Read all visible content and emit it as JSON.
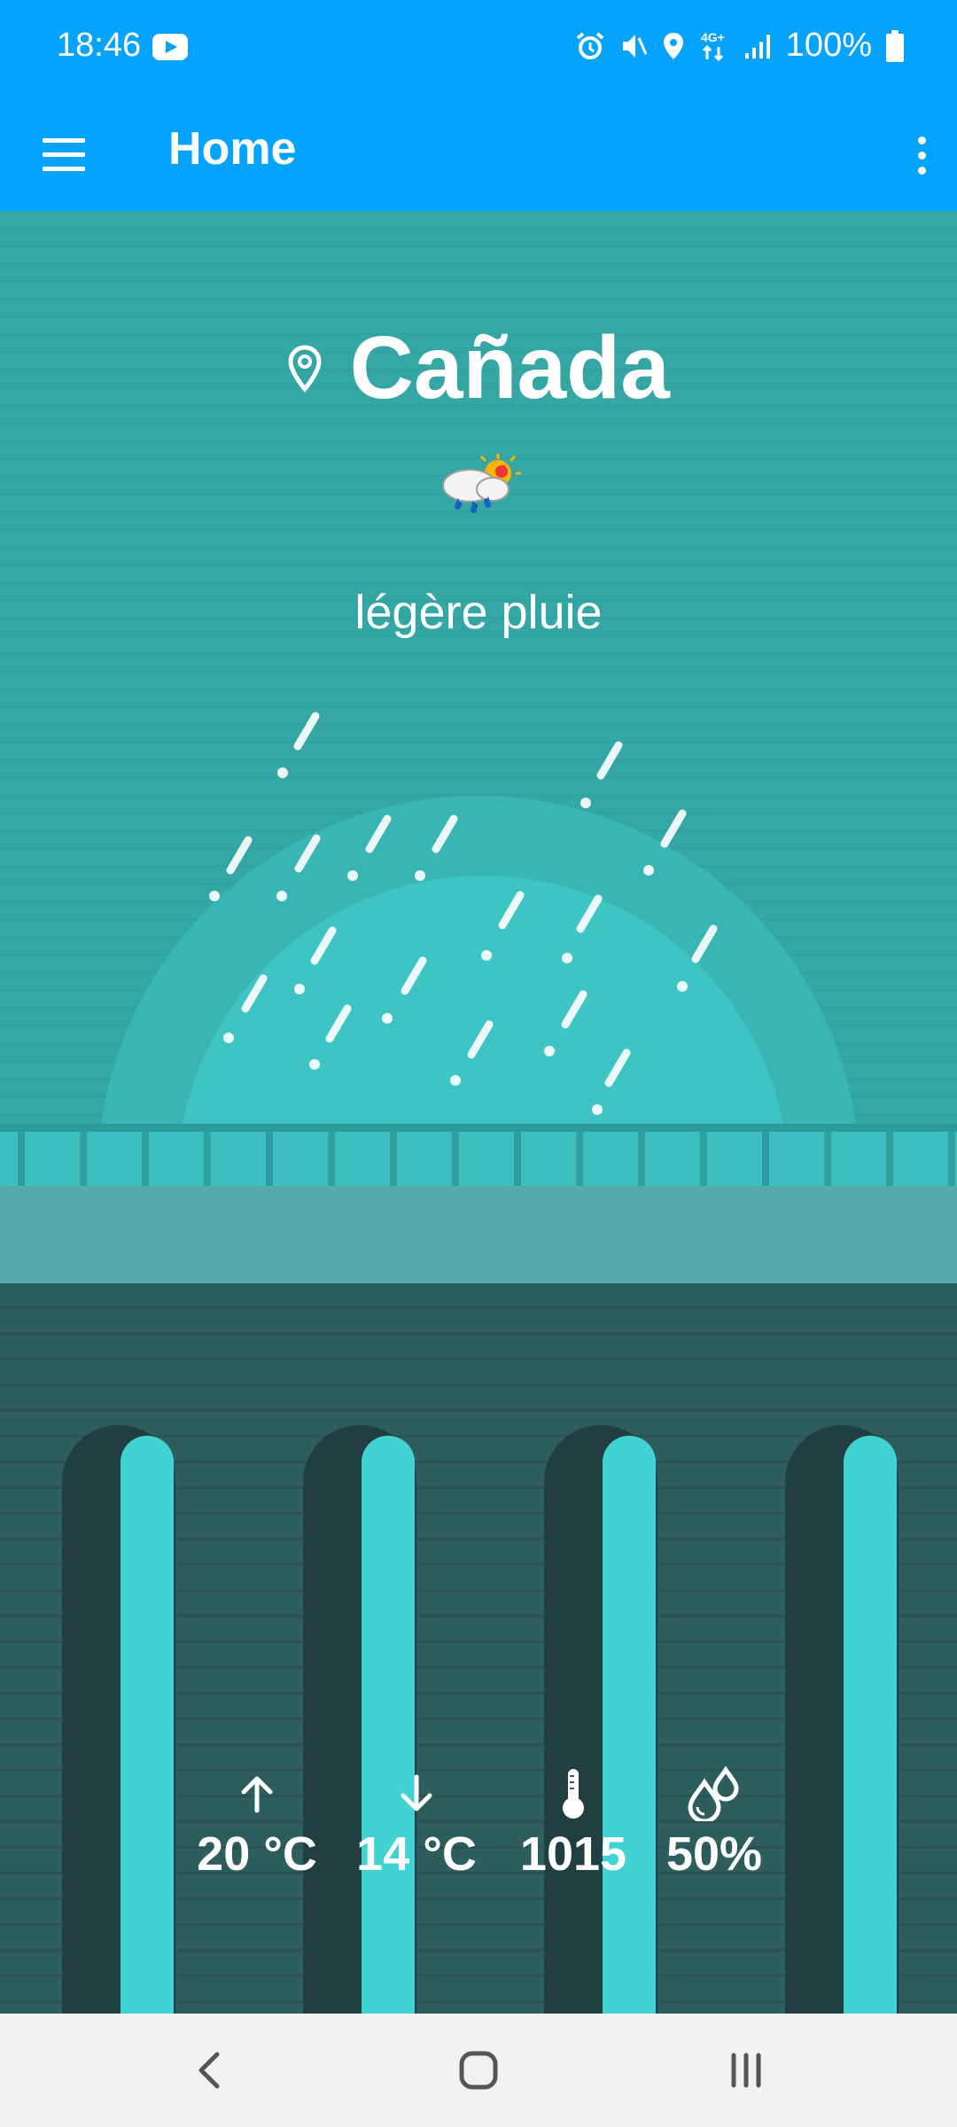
{
  "status_bar": {
    "time": "18:46",
    "battery": "100%",
    "network": "4G+",
    "icons": [
      "youtube-icon",
      "alarm-icon",
      "mute-icon",
      "location-icon",
      "data-icon",
      "signal-icon",
      "battery-icon"
    ]
  },
  "app_bar": {
    "title": "Home",
    "menu_icon": "menu-icon",
    "more_icon": "more-vert-icon",
    "color": "#03a3ff"
  },
  "weather": {
    "city": "Cañada",
    "description": "légère pluie",
    "icon": "rain-sun-icon"
  },
  "stats": {
    "max_temp": "20 °C",
    "min_temp": "14 °C",
    "pressure": "1015",
    "humidity": "50%"
  },
  "colors": {
    "sky": "#34a7a5",
    "wall": "#2e5d5e",
    "pillar_light": "#41d3d3",
    "pillar_dark": "#213f41"
  },
  "nav_bar": {
    "buttons": [
      "back-icon",
      "home-icon",
      "recents-icon"
    ]
  }
}
